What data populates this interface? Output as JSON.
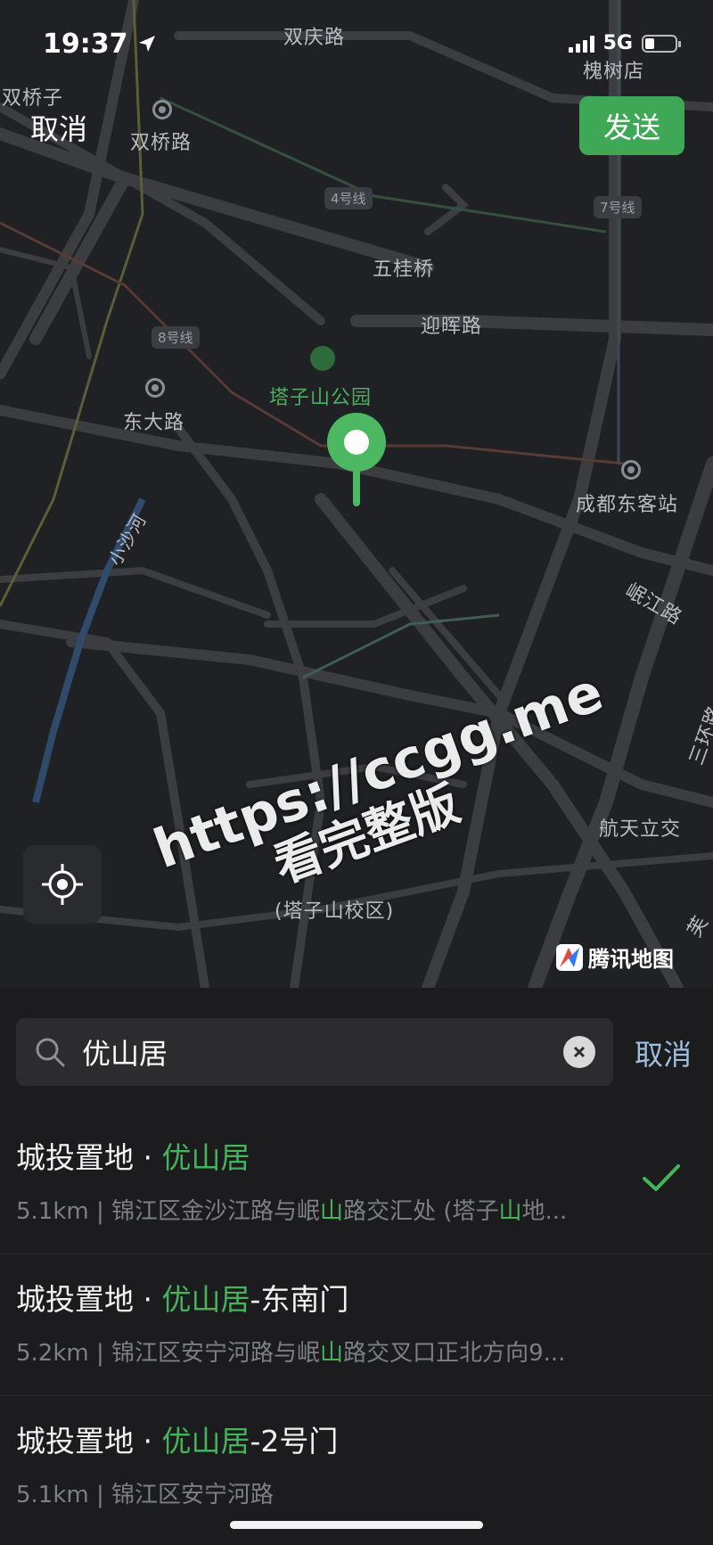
{
  "status_bar": {
    "time": "19:37",
    "network": "5G"
  },
  "header": {
    "cancel_label": "取消",
    "send_label": "发送"
  },
  "map": {
    "labels": {
      "shuangqing_road": "双庆路",
      "huaishu_store": "槐树店",
      "shuangqiaozi": "双桥子",
      "shuangqiao_road": "双桥路",
      "wuguiqiao": "五桂桥",
      "yinghui_road": "迎晖路",
      "tazishan_park": "塔子山公园",
      "dongda_road": "东大路",
      "chengdu_east_station": "成都东客站",
      "xiaosha_river": "小沙河",
      "minjiang_road": "岷江路",
      "third_ring_road": "三环路",
      "hangtian_interchange": "航天立交",
      "school": "(塔子山校区)",
      "edge": "芙"
    },
    "metro_lines": {
      "line4": "4号线",
      "line7": "7号线",
      "line8": "8号线"
    },
    "provider": "腾讯地图",
    "watermark_url": "https://ccgg.me",
    "watermark_text": "看完整版",
    "accent_color": "#3fa857"
  },
  "search": {
    "query": "优山居",
    "cancel_label": "取消"
  },
  "results": [
    {
      "title_prefix": "城投置地 · ",
      "title_highlight": "优山居",
      "title_suffix": "",
      "distance": "5.1km",
      "sep": " | ",
      "addr_a": "锦江区金沙江路与岷",
      "addr_hl": "山",
      "addr_b": "路交汇处 (塔子",
      "addr_hl2": "山",
      "addr_c": "地...",
      "selected": true
    },
    {
      "title_prefix": "城投置地 · ",
      "title_highlight": "优山居",
      "title_suffix": "-东南门",
      "distance": "5.2km",
      "sep": " | ",
      "addr_a": "锦江区安宁河路与岷",
      "addr_hl": "山",
      "addr_b": "路交叉口正北方向9...",
      "addr_hl2": "",
      "addr_c": "",
      "selected": false
    },
    {
      "title_prefix": "城投置地 · ",
      "title_highlight": "优山居",
      "title_suffix": "-2号门",
      "distance": "5.1km",
      "sep": " | ",
      "addr_a": "锦江区安宁河路",
      "addr_hl": "",
      "addr_b": "",
      "addr_hl2": "",
      "addr_c": "",
      "selected": false
    }
  ]
}
